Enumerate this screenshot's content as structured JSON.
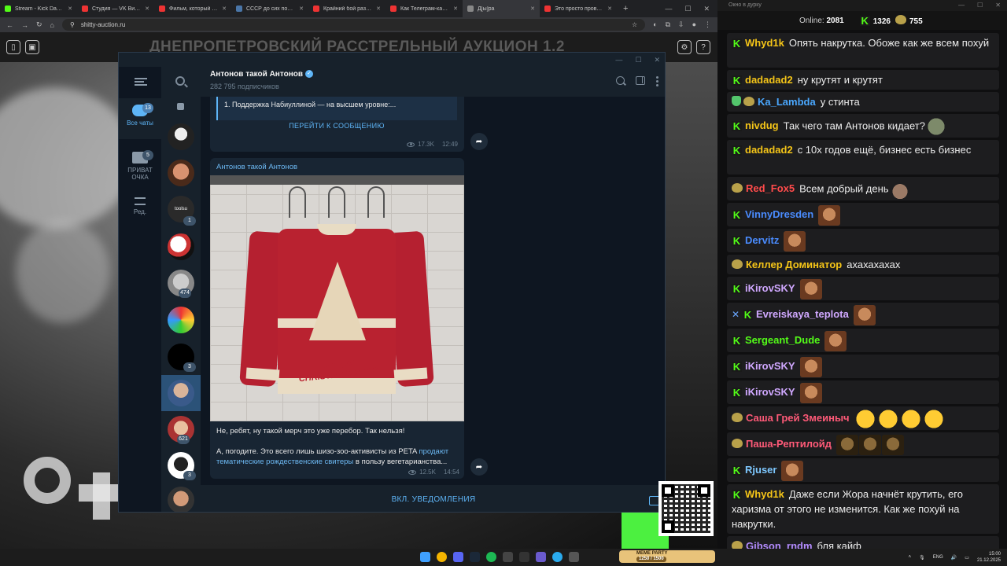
{
  "browser": {
    "tabs": [
      {
        "label": "Stream - Kick Dashboard",
        "color": "#53fc18",
        "active": false
      },
      {
        "label": "Студия — VK Видео Live",
        "color": "#e33",
        "active": false
      },
      {
        "label": "Фильм, который сломал",
        "color": "#e33",
        "active": false
      },
      {
        "label": "СССР до сих пор существ",
        "color": "#4a76a8",
        "active": false
      },
      {
        "label": "Крайний бой разведчи",
        "color": "#e33",
        "active": false
      },
      {
        "label": "Как Телеграм-каналы",
        "color": "#e33",
        "active": false
      },
      {
        "label": "Д[ы]ра",
        "color": "#888",
        "active": true
      },
      {
        "label": "Это просто проверка",
        "color": "#e33",
        "active": false
      }
    ],
    "url": "shitty-auction.ru"
  },
  "site": {
    "title": "ДНЕПРОПЕТРОВСКИЙ РАССТРЕЛЬНЫЙ АУКЦИОН 1.2"
  },
  "telegram": {
    "folders": [
      {
        "label": "Все чаты",
        "badge": "13",
        "active": true
      },
      {
        "label": "ПРИВАТ ОЧКА",
        "badge": "5",
        "active": false
      },
      {
        "label": "Ред.",
        "badge": "",
        "active": false
      }
    ],
    "chatlist_badges": [
      "1",
      "474",
      "3",
      "621",
      "3"
    ],
    "avatar_text": "toolsu",
    "channel": {
      "name": "Антонов такой Антонов",
      "subscribers": "282 795 подписчиков"
    },
    "quote_text": "1. Поддержка Набиуллиной — на высшем уровне:...",
    "goto_label": "ПЕРЕЙТИ К СООБЩЕНИЮ",
    "msg1_views": "17.3K",
    "msg1_time": "12:49",
    "post": {
      "author": "Антонов такой Антонов",
      "sweater_text": "HAPPY CHRISTMASSACRE",
      "text1": "Не, ребят, ну такой мерч это уже перебор. Так нельзя!",
      "text2_pre": "А, погодите. Это всего лишь шизо-зоо-активисты из PETA ",
      "text2_link": "продают тематические рождественские свитеры",
      "text2_post": " в пользу вегетарианства...",
      "views": "12.5K",
      "time": "14:54"
    },
    "notify_label": "ВКЛ. УВЕДОМЛЕНИЯ"
  },
  "taskbar": {
    "meme_label": "MEME PARTY",
    "meme_count": "1250 / 1500",
    "lang": "ENG",
    "time": "15:00",
    "date": "21.12.2025"
  },
  "chat": {
    "window_title": "Окно в дурку",
    "online_label": "Online:",
    "online_count": "2081",
    "kick_count": "1326",
    "other_count": "755",
    "messages": [
      {
        "user": "Whyd1k",
        "color": "#f5c518",
        "badge": "k",
        "text": "Опять накрутка. Обоже как же всем похуй",
        "emotes": []
      },
      {
        "user": "dadadad2",
        "color": "#f5c518",
        "badge": "k",
        "text": "ну крутят и крутят",
        "emotes": []
      },
      {
        "user": "Ka_Lambda",
        "color": "#4aa8ff",
        "badge": "sg",
        "text": "у стинта",
        "emotes": []
      },
      {
        "user": "nivdug",
        "color": "#f5c518",
        "badge": "k",
        "text": "Так чего там Антонов кидает?",
        "emotes": [
          "green"
        ]
      },
      {
        "user": "dadadad2",
        "color": "#f5c518",
        "badge": "k",
        "text": "с 10х годов ещё, бизнес есть бизнес",
        "emotes": []
      },
      {
        "user": "Red_Fox5",
        "color": "#ff4b4b",
        "badge": "g",
        "text": "Всем добрый день",
        "emotes": [
          "hand"
        ]
      },
      {
        "user": "VinnyDresden",
        "color": "#4a8cff",
        "badge": "k",
        "text": "",
        "emotes": [
          "face"
        ]
      },
      {
        "user": "Dervitz",
        "color": "#4a8cff",
        "badge": "k",
        "text": "",
        "emotes": [
          "face"
        ]
      },
      {
        "user": "Келлер Доминатор",
        "color": "#f5c518",
        "badge": "g",
        "text": "ахахахахах",
        "emotes": []
      },
      {
        "user": "iKirovSKY",
        "color": "#d0a8ff",
        "badge": "k",
        "text": "",
        "emotes": [
          "face"
        ]
      },
      {
        "user": "Evreiskaya_teplota",
        "color": "#d0a8ff",
        "badge": "pk",
        "text": "",
        "emotes": [
          "face"
        ]
      },
      {
        "user": "Sergeant_Dude",
        "color": "#53fc18",
        "badge": "k",
        "text": "",
        "emotes": [
          "face"
        ]
      },
      {
        "user": "iKirovSKY",
        "color": "#d0a8ff",
        "badge": "k",
        "text": "",
        "emotes": [
          "face"
        ]
      },
      {
        "user": "iKirovSKY",
        "color": "#d0a8ff",
        "badge": "k",
        "text": "",
        "emotes": [
          "face"
        ]
      },
      {
        "user": "Саша Грей Змеиныч",
        "color": "#ff5a78",
        "badge": "g",
        "text": "",
        "emotes": [
          "cry",
          "cry",
          "cry",
          "cry"
        ]
      },
      {
        "user": "Паша-Рептилойд",
        "color": "#ff5a78",
        "badge": "g",
        "text": "",
        "emotes": [
          "dark",
          "dark",
          "dark"
        ]
      },
      {
        "user": "Rjuser",
        "color": "#7ec8ff",
        "badge": "k",
        "text": "",
        "emotes": [
          "face"
        ]
      },
      {
        "user": "Whyd1k",
        "color": "#f5c518",
        "badge": "k",
        "text": "Даже если Жора начнёт крутить, его харизма от этого не изменится. Как же похуй на накрутки.",
        "emotes": []
      },
      {
        "user": "Gibson_rndm",
        "color": "#b48cff",
        "badge": "g",
        "text": "бля кайф",
        "emotes": []
      }
    ]
  }
}
